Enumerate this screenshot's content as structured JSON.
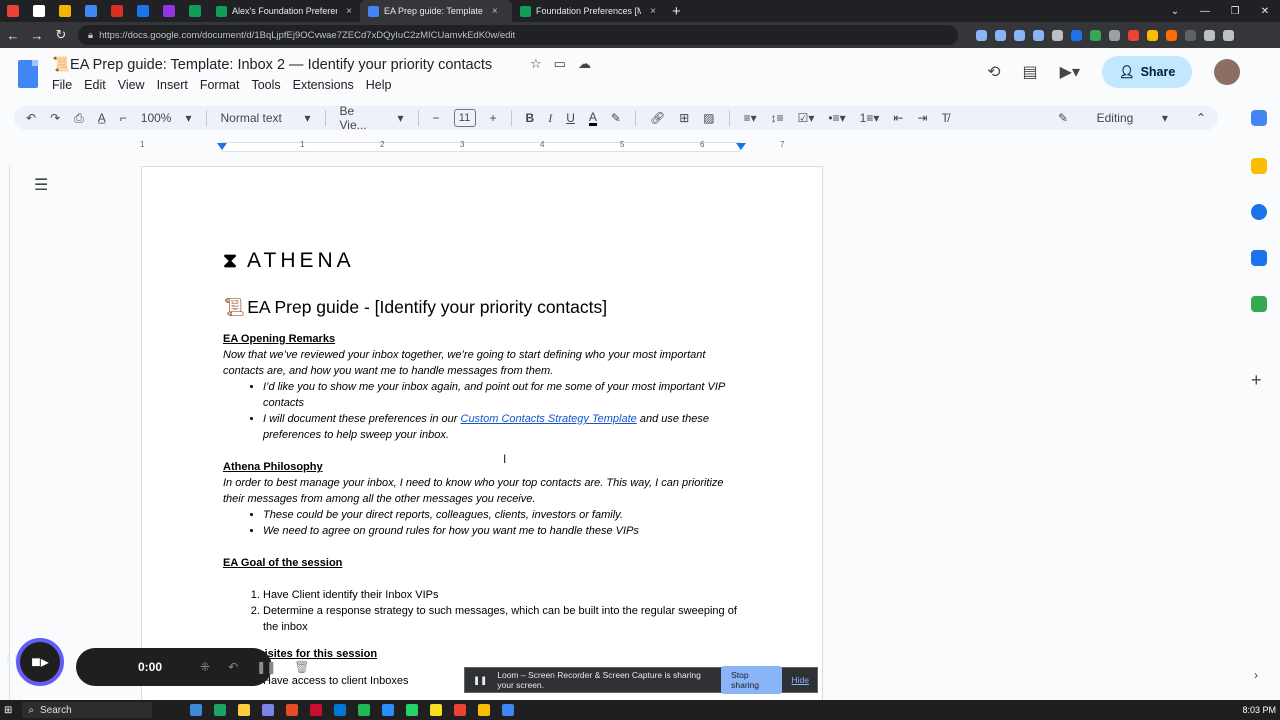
{
  "browser": {
    "tabs": [
      {
        "title": "Alex's Foundation Preference",
        "color": "#0f9d58",
        "active": false
      },
      {
        "title": "EA Prep guide: Template",
        "color": "#4285f4",
        "active": true
      },
      {
        "title": "Foundation Preferences [MASTE",
        "color": "#0f9d58",
        "active": false
      }
    ],
    "pinned_colors": [
      "#ea4335",
      "#ffffff",
      "#f4b400",
      "#4285f4",
      "#d93025",
      "#1a73e8",
      "#9334e6",
      "#0f9d58"
    ],
    "url": "https://docs.google.com/document/d/1BqLjpfEj9OCvwae7ZECd7xDQyIuC2zMICUamvkEdK0w/edit",
    "new_tab": "+",
    "close": "×"
  },
  "docs": {
    "title": "📜EA Prep guide: Template: Inbox 2 — Identify your priority contacts",
    "menus": [
      "File",
      "Edit",
      "View",
      "Insert",
      "Format",
      "Tools",
      "Extensions",
      "Help"
    ],
    "share_label": "Share",
    "toolbar": {
      "zoom": "100%",
      "style": "Normal text",
      "font": "Be Vie...",
      "font_size": "11",
      "mode": "Editing"
    }
  },
  "ruler": [
    "1",
    "1",
    "2",
    "3",
    "4",
    "5",
    "6",
    "7"
  ],
  "document": {
    "brand": "ATHENA",
    "heading": "EA Prep guide - [Identify your priority contacts]",
    "section1_title": "EA Opening Remarks",
    "section1_para": "Now that we’ve reviewed your inbox together, we’re going to start defining who your most important contacts are, and how you want me to handle messages from them.",
    "section1_b1": "I’d like you to show me your inbox again, and point out for me some of your most important VIP contacts",
    "section1_b2_pre": "I will document these preferences in our ",
    "section1_b2_link": "Custom Contacts Strategy Template",
    "section1_b2_post": " and use these preferences to help sweep your inbox.",
    "section2_title": "Athena Philosophy",
    "section2_para": "In order to best manage your inbox, I need to know who your top contacts are. This way, I can prioritize their messages from among all the other messages you receive.",
    "section2_b1": "These could be your direct reports, colleagues, clients, investors or family.",
    "section2_b2": "We need to agree on ground rules for how you want me to handle these VIPs",
    "section3_title": "EA Goal of the session",
    "section3_i1": "Have Client identify their Inbox VIPs",
    "section3_i2": "Determine a response strategy to such messages, which can be built into the regular sweeping of the inbox",
    "section4_title": "Prerequisites for this session",
    "section4_i1": "Have access to client Inboxes"
  },
  "loom": {
    "time": "0:00",
    "share_text": "Loom – Screen Recorder & Screen Capture is sharing your screen.",
    "stop_label": "Stop sharing",
    "hide_label": "Hide"
  },
  "taskbar": {
    "search": "Search",
    "clock": "8:03 PM",
    "app_colors": [
      "#3c8bd9",
      "#1da462",
      "#ffcd40",
      "#7b83eb",
      "#e34c26",
      "#c8102e",
      "#0078d4",
      "#1db954",
      "#2d8cff",
      "#25d366",
      "#f7df1e",
      "#ea4335",
      "#fbbc04",
      "#4285f4"
    ]
  },
  "side_panel_colors": [
    "#4285f4",
    "#fbbc04",
    "#1a73e8",
    "#1a73e8",
    "#34a853"
  ]
}
